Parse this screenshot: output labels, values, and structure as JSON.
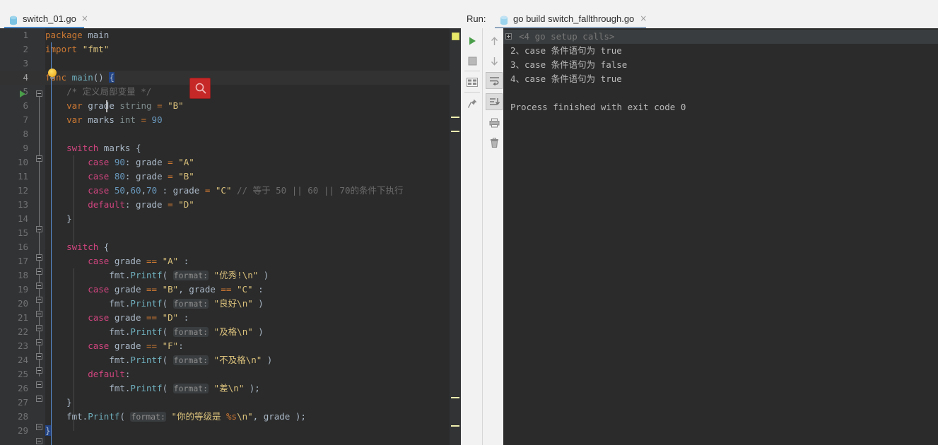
{
  "window": {
    "background_tab": {
      "label": "go build switch_fallthrough.go",
      "close_icon": "×"
    }
  },
  "editor": {
    "tab": {
      "label": "switch_01.go",
      "file_icon": "go-file-icon",
      "close_icon": "×"
    },
    "search_badge_icon": "search-icon",
    "lines": [
      {
        "n": "1",
        "segments": [
          {
            "t": "package",
            "c": "kw"
          },
          {
            "t": " main",
            "c": "id"
          }
        ]
      },
      {
        "n": "2",
        "segments": [
          {
            "t": "import",
            "c": "kw"
          },
          {
            "t": " ",
            "c": "id"
          },
          {
            "t": "\"fmt\"",
            "c": "str"
          }
        ]
      },
      {
        "n": "3",
        "segments": []
      },
      {
        "n": "4",
        "segments": [
          {
            "t": "func",
            "c": "kw"
          },
          {
            "t": " ",
            "c": "id"
          },
          {
            "t": "main",
            "c": "fn"
          },
          {
            "t": "() ",
            "c": "id"
          },
          {
            "t": "{",
            "c": "sel"
          }
        ]
      },
      {
        "n": "5",
        "segments": [
          {
            "t": "    /* 定义局部变量 */",
            "c": "cmt"
          }
        ]
      },
      {
        "n": "6",
        "segments": [
          {
            "t": "    ",
            "c": "id"
          },
          {
            "t": "var",
            "c": "kw"
          },
          {
            "t": " grade ",
            "c": "id"
          },
          {
            "t": "string",
            "c": "typ"
          },
          {
            "t": " ",
            "c": "id"
          },
          {
            "t": "=",
            "c": "kw"
          },
          {
            "t": " ",
            "c": "id"
          },
          {
            "t": "\"B\"",
            "c": "str"
          }
        ]
      },
      {
        "n": "7",
        "segments": [
          {
            "t": "    ",
            "c": "id"
          },
          {
            "t": "var",
            "c": "kw"
          },
          {
            "t": " marks ",
            "c": "id"
          },
          {
            "t": "int",
            "c": "typ"
          },
          {
            "t": " ",
            "c": "id"
          },
          {
            "t": "=",
            "c": "kw"
          },
          {
            "t": " ",
            "c": "id"
          },
          {
            "t": "90",
            "c": "num"
          }
        ]
      },
      {
        "n": "8",
        "segments": []
      },
      {
        "n": "9",
        "segments": [
          {
            "t": "    ",
            "c": "id"
          },
          {
            "t": "switch",
            "c": "kwp"
          },
          {
            "t": " marks {",
            "c": "id"
          }
        ]
      },
      {
        "n": "10",
        "segments": [
          {
            "t": "        ",
            "c": "id"
          },
          {
            "t": "case",
            "c": "kwp"
          },
          {
            "t": " ",
            "c": "id"
          },
          {
            "t": "90",
            "c": "num"
          },
          {
            "t": ": grade ",
            "c": "id"
          },
          {
            "t": "=",
            "c": "kw"
          },
          {
            "t": " ",
            "c": "id"
          },
          {
            "t": "\"A\"",
            "c": "str"
          }
        ]
      },
      {
        "n": "11",
        "segments": [
          {
            "t": "        ",
            "c": "id"
          },
          {
            "t": "case",
            "c": "kwp"
          },
          {
            "t": " ",
            "c": "id"
          },
          {
            "t": "80",
            "c": "num"
          },
          {
            "t": ": grade ",
            "c": "id"
          },
          {
            "t": "=",
            "c": "kw"
          },
          {
            "t": " ",
            "c": "id"
          },
          {
            "t": "\"B\"",
            "c": "str"
          }
        ]
      },
      {
        "n": "12",
        "segments": [
          {
            "t": "        ",
            "c": "id"
          },
          {
            "t": "case",
            "c": "kwp"
          },
          {
            "t": " ",
            "c": "id"
          },
          {
            "t": "50",
            "c": "num"
          },
          {
            "t": ",",
            "c": "id"
          },
          {
            "t": "60",
            "c": "num"
          },
          {
            "t": ",",
            "c": "id"
          },
          {
            "t": "70",
            "c": "num"
          },
          {
            "t": " : grade ",
            "c": "id"
          },
          {
            "t": "=",
            "c": "kw"
          },
          {
            "t": " ",
            "c": "id"
          },
          {
            "t": "\"C\"",
            "c": "str"
          },
          {
            "t": " // 等于 50 || 60 || 70的条件下执行",
            "c": "cmt"
          }
        ]
      },
      {
        "n": "13",
        "segments": [
          {
            "t": "        ",
            "c": "id"
          },
          {
            "t": "default",
            "c": "kwp"
          },
          {
            "t": ": grade ",
            "c": "id"
          },
          {
            "t": "=",
            "c": "kw"
          },
          {
            "t": " ",
            "c": "id"
          },
          {
            "t": "\"D\"",
            "c": "str"
          }
        ]
      },
      {
        "n": "14",
        "segments": [
          {
            "t": "    }",
            "c": "id"
          }
        ]
      },
      {
        "n": "15",
        "segments": []
      },
      {
        "n": "16",
        "segments": [
          {
            "t": "    ",
            "c": "id"
          },
          {
            "t": "switch",
            "c": "kwp"
          },
          {
            "t": " {",
            "c": "id"
          }
        ]
      },
      {
        "n": "17",
        "segments": [
          {
            "t": "        ",
            "c": "id"
          },
          {
            "t": "case",
            "c": "kwp"
          },
          {
            "t": " grade ",
            "c": "id"
          },
          {
            "t": "==",
            "c": "kw"
          },
          {
            "t": " ",
            "c": "id"
          },
          {
            "t": "\"A\"",
            "c": "str"
          },
          {
            "t": " :",
            "c": "id"
          }
        ]
      },
      {
        "n": "18",
        "segments": [
          {
            "t": "            fmt.",
            "c": "id"
          },
          {
            "t": "Printf",
            "c": "fn"
          },
          {
            "t": "( ",
            "c": "id"
          },
          {
            "t": "format:",
            "c": "hint"
          },
          {
            "t": " ",
            "c": "id"
          },
          {
            "t": "\"优秀!\\n\"",
            "c": "str"
          },
          {
            "t": " )",
            "c": "id"
          }
        ]
      },
      {
        "n": "19",
        "segments": [
          {
            "t": "        ",
            "c": "id"
          },
          {
            "t": "case",
            "c": "kwp"
          },
          {
            "t": " grade ",
            "c": "id"
          },
          {
            "t": "==",
            "c": "kw"
          },
          {
            "t": " ",
            "c": "id"
          },
          {
            "t": "\"B\"",
            "c": "str"
          },
          {
            "t": ", grade ",
            "c": "id"
          },
          {
            "t": "==",
            "c": "kw"
          },
          {
            "t": " ",
            "c": "id"
          },
          {
            "t": "\"C\"",
            "c": "str"
          },
          {
            "t": " :",
            "c": "id"
          }
        ]
      },
      {
        "n": "20",
        "segments": [
          {
            "t": "            fmt.",
            "c": "id"
          },
          {
            "t": "Printf",
            "c": "fn"
          },
          {
            "t": "( ",
            "c": "id"
          },
          {
            "t": "format:",
            "c": "hint"
          },
          {
            "t": " ",
            "c": "id"
          },
          {
            "t": "\"良好\\n\"",
            "c": "str"
          },
          {
            "t": " )",
            "c": "id"
          }
        ]
      },
      {
        "n": "21",
        "segments": [
          {
            "t": "        ",
            "c": "id"
          },
          {
            "t": "case",
            "c": "kwp"
          },
          {
            "t": " grade ",
            "c": "id"
          },
          {
            "t": "==",
            "c": "kw"
          },
          {
            "t": " ",
            "c": "id"
          },
          {
            "t": "\"D\"",
            "c": "str"
          },
          {
            "t": " :",
            "c": "id"
          }
        ]
      },
      {
        "n": "22",
        "segments": [
          {
            "t": "            fmt.",
            "c": "id"
          },
          {
            "t": "Printf",
            "c": "fn"
          },
          {
            "t": "( ",
            "c": "id"
          },
          {
            "t": "format:",
            "c": "hint"
          },
          {
            "t": " ",
            "c": "id"
          },
          {
            "t": "\"及格\\n\"",
            "c": "str"
          },
          {
            "t": " )",
            "c": "id"
          }
        ]
      },
      {
        "n": "23",
        "segments": [
          {
            "t": "        ",
            "c": "id"
          },
          {
            "t": "case",
            "c": "kwp"
          },
          {
            "t": " grade ",
            "c": "id"
          },
          {
            "t": "==",
            "c": "kw"
          },
          {
            "t": " ",
            "c": "id"
          },
          {
            "t": "\"F\"",
            "c": "str"
          },
          {
            "t": ":",
            "c": "id"
          }
        ]
      },
      {
        "n": "24",
        "segments": [
          {
            "t": "            fmt.",
            "c": "id"
          },
          {
            "t": "Printf",
            "c": "fn"
          },
          {
            "t": "( ",
            "c": "id"
          },
          {
            "t": "format:",
            "c": "hint"
          },
          {
            "t": " ",
            "c": "id"
          },
          {
            "t": "\"不及格\\n\"",
            "c": "str"
          },
          {
            "t": " )",
            "c": "id"
          }
        ]
      },
      {
        "n": "25",
        "segments": [
          {
            "t": "        ",
            "c": "id"
          },
          {
            "t": "default",
            "c": "kwp"
          },
          {
            "t": ":",
            "c": "id"
          }
        ]
      },
      {
        "n": "26",
        "segments": [
          {
            "t": "            fmt.",
            "c": "id"
          },
          {
            "t": "Printf",
            "c": "fn"
          },
          {
            "t": "( ",
            "c": "id"
          },
          {
            "t": "format:",
            "c": "hint"
          },
          {
            "t": " ",
            "c": "id"
          },
          {
            "t": "\"差\\n\"",
            "c": "str"
          },
          {
            "t": " );",
            "c": "id"
          }
        ]
      },
      {
        "n": "27",
        "segments": [
          {
            "t": "    }",
            "c": "id"
          }
        ]
      },
      {
        "n": "28",
        "segments": [
          {
            "t": "    fmt.",
            "c": "id"
          },
          {
            "t": "Printf",
            "c": "fn"
          },
          {
            "t": "( ",
            "c": "id"
          },
          {
            "t": "format:",
            "c": "hint"
          },
          {
            "t": " ",
            "c": "id"
          },
          {
            "t": "\"你的等级是 ",
            "c": "str"
          },
          {
            "t": "%s",
            "c": "kw"
          },
          {
            "t": "\\n\"",
            "c": "str"
          },
          {
            "t": ", grade );",
            "c": "id"
          }
        ]
      },
      {
        "n": "29",
        "segments": [
          {
            "t": "}",
            "c": "sel"
          }
        ]
      }
    ],
    "current_line": "4",
    "gutter_run_arrow_line": "4",
    "bulb_line": "3"
  },
  "run_panel": {
    "label": "Run:",
    "tab": {
      "label": "go build switch_fallthrough.go",
      "file_icon": "go-file-icon",
      "close_icon": "×"
    },
    "toolbar_left": [
      {
        "name": "rerun-button",
        "icon": "play-icon"
      },
      {
        "name": "stop-button",
        "icon": "stop-square-icon"
      },
      {
        "name": "console-view-button",
        "icon": "console-grid-icon"
      },
      {
        "name": "pin-tab-button",
        "icon": "pin-icon"
      }
    ],
    "toolbar_right": [
      {
        "name": "prev-occurrence-button",
        "icon": "arrow-up-icon"
      },
      {
        "name": "next-occurrence-button",
        "icon": "arrow-down-icon"
      },
      {
        "name": "soft-wrap-button",
        "icon": "soft-wrap-icon"
      },
      {
        "name": "scroll-to-end-button",
        "icon": "scroll-to-end-icon"
      },
      {
        "name": "print-button",
        "icon": "printer-icon"
      },
      {
        "name": "clear-all-button",
        "icon": "trash-icon"
      }
    ],
    "console_lines": [
      {
        "text": "<4 go setup calls>",
        "folded": true
      },
      {
        "text": "2、case 条件语句为 true",
        "folded": false
      },
      {
        "text": "3、case 条件语句为 false",
        "folded": false
      },
      {
        "text": "4、case 条件语句为 true",
        "folded": false
      },
      {
        "text": "",
        "folded": false
      },
      {
        "text": "Process finished with exit code 0",
        "folded": false
      }
    ]
  },
  "colors": {
    "editor_bg": "#2b2b2b",
    "gutter_bg": "#313335",
    "current_line_bg": "#323232",
    "chrome_bg": "#f2f2f2",
    "tab_accent": "#4a88c7",
    "run_accent": "#4a9e4a",
    "search_badge": "#c62828",
    "marker_yellow": "#f0f0b0"
  }
}
